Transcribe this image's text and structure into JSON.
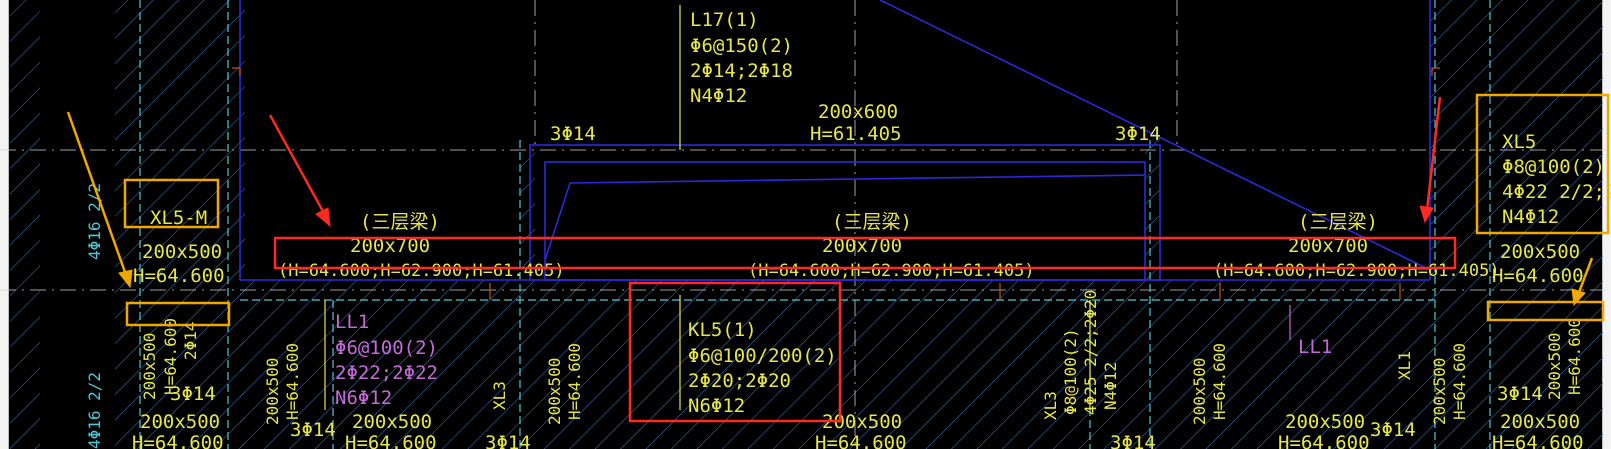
{
  "colors": {
    "background": "#000000",
    "text_yellow": "#e6e64a",
    "text_purple": "#c36ad6",
    "text_cyan": "#4ec7d6",
    "beam_blue": "#2a2ad8",
    "hatch": "#3c6aa8",
    "callout_red": "#ff2a1e",
    "callout_orange": "#f0a800"
  },
  "icons": {
    "arrow_left": "red-arrow-icon",
    "arrow_right": "red-arrow-icon",
    "arrow_orange": "orange-arrow-icon"
  },
  "labels": {
    "l17_name": "L17(1)",
    "l17_stirrup": "Φ6@150(2)",
    "l17_bars": "2Φ14;2Φ18",
    "l17_side": "N4Φ12",
    "top_size": "200x600",
    "top_height": "H=61.405",
    "top_left_bars": "3Φ14",
    "top_right_bars": "3Φ14",
    "beam_a_note": "(三层梁)",
    "beam_a_size": "200x700",
    "beam_a_height": "(H=64.600;H=62.900;H=61.405)",
    "beam_b_note": "(三层梁)",
    "beam_b_size": "200x700",
    "beam_b_height": "(H=64.600;H=62.900;H=61.405)",
    "beam_c_note": "(三层梁)",
    "beam_c_size": "200x700",
    "beam_c_height": "(H=64.600;H=62.900;H=61.405)",
    "xl5m": "XL5-M",
    "left_size": "200x500",
    "left_height": "H=64.600",
    "xl5_name": "XL5",
    "xl5_stirrup": "Φ8@100(2)",
    "xl5_bars": "4Φ22 2/2;2Φ",
    "xl5_side": "N4Φ12",
    "right_size": "200x500",
    "right_height": "H=64.600",
    "ll1_name": "LL1",
    "ll1_stirrup": "Φ6@100(2)",
    "ll1_bars": "2Φ22;2Φ22",
    "ll1_side": "N6Φ12",
    "kl5_name": "KL5(1)",
    "kl5_stirrup": "Φ6@100/200(2)",
    "kl5_bars": "2Φ20;2Φ20",
    "kl5_side": "N6Φ12",
    "ll1_right": "LL1",
    "left_vert": "4Φ16 2/2",
    "left_vert2": "4Φ16 2/2",
    "left_v_size": "200x500",
    "left_v_height": "H=64.600",
    "left_v_bars": "2Φ14",
    "bottom_3phi14_a": "3Φ14",
    "bottom_size_a": "200x500",
    "bottom_height_a": "H=64.600",
    "v_size_b": "200x500",
    "v_height_b": "H=64.600",
    "bottom_3phi14_b": "3Φ14",
    "bottom_size_b": "200x500",
    "bottom_height_b": "H=64.600",
    "xl3": "XL3",
    "v_size_c": "200x500",
    "v_height_c": "H=64.600",
    "bottom_3phi14_c": "3Φ14",
    "bottom_size_c": "200x500",
    "bottom_height_c": "H=64.600",
    "xl3_b_name": "XL3",
    "xl3_b_stirrup": "Φ8@100(2)",
    "xl3_b_bars": "4Φ25 2/2;2Φ20",
    "xl3_b_side": "N4Φ12",
    "bottom_3phi14_d": "3Φ14",
    "v_size_d": "200x500",
    "v_height_d": "H=64.600",
    "bottom_size_d": "200x500",
    "bottom_height_d": "H=64.600",
    "xl1": "XL1",
    "v_size_e": "200x500",
    "v_height_e": "H=64.600",
    "bottom_3phi14_e": "3Φ14",
    "bottom_3phi14_f": "3Φ14",
    "v_size_f": "200x500",
    "v_height_f": "H=64.600",
    "bottom_size_f": "200x500",
    "bottom_height_f": "H=64.600"
  }
}
